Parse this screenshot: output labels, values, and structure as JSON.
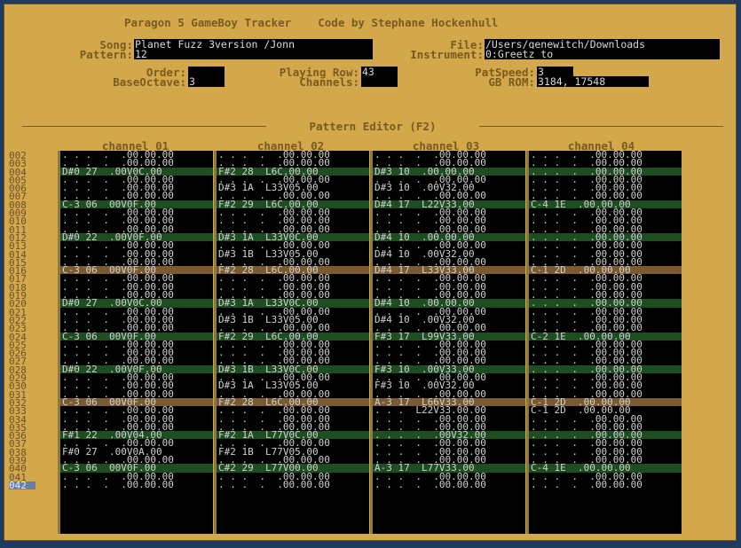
{
  "header": {
    "title": "Paragon 5 GameBoy Tracker    Code by Stephane Hockenhull"
  },
  "song": {
    "label": "Song:",
    "value": "Planet Fuzz 3version /Jonn"
  },
  "file": {
    "label": "File:",
    "value": "/Users/genewitch/Downloads"
  },
  "pattern": {
    "label": "Pattern:",
    "value": "12"
  },
  "instrument": {
    "label": "Instrument:",
    "value": "0:Greetz to"
  },
  "order": {
    "label": "Order:",
    "value": ""
  },
  "playing_row": {
    "label": "Playing Row:",
    "value": "43"
  },
  "patspeed": {
    "label": "PatSpeed:",
    "value": "3"
  },
  "baseoctave": {
    "label": "BaseOctave:",
    "value": "3"
  },
  "channels": {
    "label": "Channels:",
    "value": ""
  },
  "gbrom": {
    "label": "GB ROM:",
    "value": "3184, 17548"
  },
  "editor_title": "Pattern Editor (F2)",
  "channel_headers": [
    "channel 01",
    "channel 02",
    "channel 03",
    "channel 04"
  ],
  "row_numbers": [
    "002",
    "003",
    "004",
    "005",
    "006",
    "007",
    "008",
    "009",
    "010",
    "011",
    "012",
    "013",
    "014",
    "015",
    "016",
    "017",
    "018",
    "019",
    "020",
    "021",
    "022",
    "023",
    "024",
    "025",
    "026",
    "027",
    "028",
    "029",
    "030",
    "031",
    "032",
    "033",
    "034",
    "035",
    "036",
    "037",
    "038",
    "039",
    "040",
    "041",
    "042"
  ],
  "current_row": "042",
  "beat_rows": [
    2,
    6,
    10,
    14,
    18,
    22,
    26,
    30,
    34,
    38
  ],
  "highlight_rows": [
    14,
    30
  ],
  "channel_rows": [
    [
      ". . .  .  .00.00.00",
      ". . .  .  .00.00.00",
      "D#0 27  .00V0C.00",
      ". . .  .  .00.00.00",
      ". . .  .  .00.00.00",
      ". . .  .  .00.00.00",
      "C-3 06  00V0F.00",
      ". . .  .  .00.00.00",
      ". . .  .  .00.00.00",
      ". . .  .  .00.00.00",
      "D#0 22  .00V0F.00",
      ". . .  .  .00.00.00",
      ". . .  .  .00.00.00",
      ". . .  .  .00.00.00",
      "C-3 06  00V0F.00",
      ". . .  .  .00.00.00",
      ". . .  .  .00.00.00",
      ". . .  .  .00.00.00",
      "D#0 27  .00V0C.00",
      ". . .  .  .00.00.00",
      ". . .  .  .00.00.00",
      ". . .  .  .00.00.00",
      "C-3 06  00V0F.00",
      ". . .  .  .00.00.00",
      ". . .  .  .00.00.00",
      ". . .  .  .00.00.00",
      "D#0 22  .00V0F.00",
      ". . .  .  .00.00.00",
      ". . .  .  .00.00.00",
      ". . .  .  .00.00.00",
      "C-3 06  00V0F.00",
      ". . .  .  .00.00.00",
      ". . .  .  .00.00.00",
      ". . .  .  .00.00.00",
      "F#1 22  .00V04.00",
      ". . .  .  .00.00.00",
      "F#0 27  .00V0A.00",
      ". . .  .  .00.00.00",
      "C-3 06  00V0F.00",
      ". . .  .  .00.00.00",
      ". . .  .  .00.00.00"
    ],
    [
      ". . .  .  .00.00.00",
      ". . .  .  .00.00.00",
      "F#2 28  L6C.00.00",
      ". . .  .  .00.00.00",
      "D#3 1A  L33V05.00",
      ". . .  .  .00.00.00",
      "F#2 29  L6C.00.00",
      ". . .  .  .00.00.00",
      ". . .  .  .00.00.00",
      ". . .  .  .00.00.00",
      "D#3 1A  L33V0C.00",
      ". . .  .  .00.00.00",
      "D#3 1B  L33V05.00",
      ". . .  .  .00.00.00",
      "F#2 28  L6C.00.00",
      ". . .  .  .00.00.00",
      ". . .  .  .00.00.00",
      ". . .  .  .00.00.00",
      "D#3 1A  L33V0C.00",
      ". . .  .  .00.00.00",
      "D#3 1B  L33V05.00",
      ". . .  .  .00.00.00",
      "F#2 29  L6C.00.00",
      ". . .  .  .00.00.00",
      ". . .  .  .00.00.00",
      ". . .  .  .00.00.00",
      "D#3 1B  L33V0C.00",
      ". . .  .  .00.00.00",
      "D#3 1A  L33V05.00",
      ". . .  .  .00.00.00",
      "F#2 28  L6C.00.00",
      ". . .  .  .00.00.00",
      ". . .  .  .00.00.00",
      ". . .  .  .00.00.00",
      "F#2 1A  L77V0C.00",
      ". . .  .  .00.00.00",
      "F#2 1B  L77V05.00",
      ". . .  .  .00.00.00",
      "C#2 29  L77V00.00",
      ". . .  .  .00.00.00",
      ". . .  .  .00.00.00"
    ],
    [
      ". . .  .  .00.00.00",
      ". . .  .  .00.00.00",
      "D#3 10  .00.00.00",
      ". . .  .  .00.00.00",
      "D#3 10  .00V32.00",
      ". . .  .  .00.00.00",
      "D#4 17  L22V33.00",
      ". . .  .  .00.00.00",
      ". . .  .  .00.00.00",
      ". . .  .  .00.00.00",
      "D#4 10  .00.00.00",
      ". . .  .  .00.00.00",
      "D#4 10  .00V32.00",
      ". . .  .  .00.00.00",
      "D#4 17  L33V33.00",
      ". . .  .  .00.00.00",
      ". . .  .  .00.00.00",
      ". . .  .  .00.00.00",
      "D#4 10  .00.00.00",
      ". . .  .  .00.00.00",
      "D#4 10  .00V32.00",
      ". . .  .  .00.00.00",
      "F#3 17  L99V33.00",
      ". . .  .  .00.00.00",
      ". . .  .  .00.00.00",
      ". . .  .  .00.00.00",
      "F#3 10  .00V33.00",
      ". . .  .  .00.00.00",
      "F#3 10  .00V32.00",
      ". . .  .  .00.00.00",
      "A-3 17  L66V33.00",
      ". . .  L22V33.00.00",
      ". . .  .  .00.00.00",
      ". . .  .  .00.00.00",
      ". . .  .  .00V32.00",
      ". . .  .  .00.00.00",
      ". . .  .  .00.00.00",
      ". . .  .  .00.00.00",
      "A-3 17  L77V33.00",
      ". . .  .  .00.00.00",
      ". . .  .  .00.00.00"
    ],
    [
      ". . .  .  .00.00.00",
      ". . .  .  .00.00.00",
      ". . .  .  .00.00.00",
      ". . .  .  .00.00.00",
      ". . .  .  .00.00.00",
      ". . .  .  .00.00.00",
      "C-4 1E  .00.00.00",
      ". . .  .  .00.00.00",
      ". . .  .  .00.00.00",
      ". . .  .  .00.00.00",
      ". . .  .  .00.00.00",
      ". . .  .  .00.00.00",
      ". . .  .  .00.00.00",
      ". . .  .  .00.00.00",
      "C-1 2D  .00.00.00",
      ". . .  .  .00.00.00",
      ". . .  .  .00.00.00",
      ". . .  .  .00.00.00",
      ". . .  .  .00.00.00",
      ". . .  .  .00.00.00",
      ". . .  .  .00.00.00",
      ". . .  .  .00.00.00",
      "C-2 1E  .00.00.00",
      ". . .  .  .00.00.00",
      ". . .  .  .00.00.00",
      ". . .  .  .00.00.00",
      ". . .  .  .00.00.00",
      ". . .  .  .00.00.00",
      ". . .  .  .00.00.00",
      ". . .  .  .00.00.00",
      "C-1 2D  .00.00.00",
      "C-1 2D  .00.00.00",
      ". . .  .  .00.00.00",
      ". . .  .  .00.00.00",
      ". . .  .  .00.00.00",
      ". . .  .  .00.00.00",
      ". . .  .  .00.00.00",
      ". . .  .  .00.00.00",
      "C-4 1E  .00.00.00",
      ". . .  .  .00.00.00",
      ". . .  .  .00.00.00"
    ]
  ]
}
